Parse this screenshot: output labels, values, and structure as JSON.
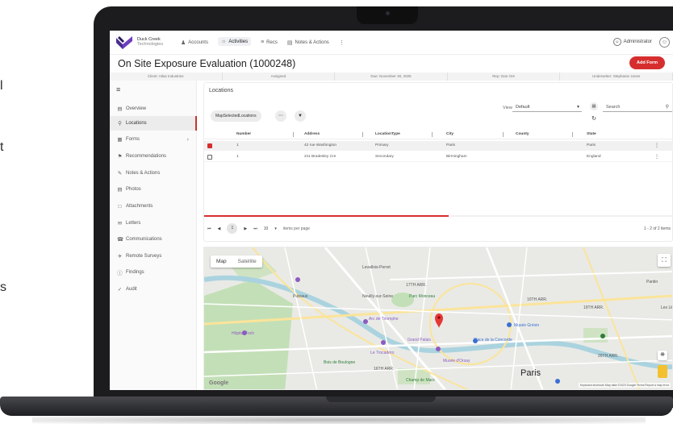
{
  "app": {
    "logo_line1": "Duck Creek",
    "logo_line2": "Technologies",
    "nav": [
      {
        "label": "Accounts",
        "icon": "person-icon"
      },
      {
        "label": "Activities",
        "icon": "activity-icon",
        "active": true
      },
      {
        "label": "Recs",
        "icon": "recs-icon"
      },
      {
        "label": "Notes & Actions",
        "icon": "notes-icon"
      }
    ],
    "user": "Administrator",
    "brand_color": "#d62e2e"
  },
  "page": {
    "title": "On Site Exposure Evaluation (1000248)",
    "add_form": "Add Form"
  },
  "info_strip": [
    "Client: Atlas Industries",
    "Assigned",
    "Due: November 30, 2025",
    "Rep: Dan Ore",
    "Underwriter: Stephanie Jones"
  ],
  "sidebar": {
    "items": [
      {
        "label": "Overview",
        "icon": "overview-icon"
      },
      {
        "label": "Locations",
        "icon": "location-pin-icon",
        "active": true
      },
      {
        "label": "Forms",
        "icon": "forms-icon",
        "chevron": true
      },
      {
        "label": "Recommendations",
        "icon": "recommendations-icon"
      },
      {
        "label": "Notes & Actions",
        "icon": "notes-icon"
      },
      {
        "label": "Photos",
        "icon": "photos-icon"
      },
      {
        "label": "Attachments",
        "icon": "attachment-icon"
      },
      {
        "label": "Letters",
        "icon": "letters-icon"
      },
      {
        "label": "Communications",
        "icon": "communications-icon"
      },
      {
        "label": "Remote Surveys",
        "icon": "remote-surveys-icon"
      },
      {
        "label": "Findings",
        "icon": "findings-icon"
      },
      {
        "label": "Audit",
        "icon": "audit-icon"
      }
    ]
  },
  "locations": {
    "title": "Locations",
    "map_selected_btn": "MapSelectedLocations",
    "view_label": "View",
    "view_value": "Default",
    "search_placeholder": "Search",
    "columns": [
      "Number",
      "Address",
      "LocationType",
      "City",
      "County",
      "State"
    ],
    "rows": [
      {
        "selected": true,
        "number": "1",
        "address": "42 rue Washington",
        "type": "Primary",
        "city": "Paris",
        "county": "",
        "state": "Paris"
      },
      {
        "selected": false,
        "number": "1",
        "address": "211 Bradesley Cre",
        "type": "Secondary",
        "city": "Birmingham",
        "county": "",
        "state": "England"
      }
    ],
    "progress_fraction": 0.52,
    "pager": {
      "page": "1",
      "per_page": "10",
      "per_page_label": "items per page",
      "items_info": "1 - 2 of 2 items"
    }
  },
  "map": {
    "tab_map": "Map",
    "tab_satellite": "Satellite",
    "city": "Paris",
    "labels": [
      {
        "text": "Levallois-Perret",
        "style": ""
      },
      {
        "text": "17TH ARR.",
        "style": ""
      },
      {
        "text": "Parc Monceau",
        "style": "green"
      },
      {
        "text": "Musée Grévin",
        "style": "blue"
      },
      {
        "text": "Grand Palais",
        "style": "purple"
      },
      {
        "text": "Place de la Concorde",
        "style": "blue"
      },
      {
        "text": "Le Trocadéro",
        "style": "purple"
      },
      {
        "text": "Arc de Triomphe",
        "style": "purple"
      },
      {
        "text": "Musée d'Orsay",
        "style": "purple"
      },
      {
        "text": "16TH ARR.",
        "style": ""
      },
      {
        "text": "Champ de Mars",
        "style": "green"
      },
      {
        "text": "Hôpital Foch",
        "style": "purple"
      },
      {
        "text": "Puteaux",
        "style": ""
      },
      {
        "text": "Neuilly-sur-Seine",
        "style": ""
      },
      {
        "text": "19TH ARR.",
        "style": ""
      },
      {
        "text": "20TH ARR.",
        "style": ""
      },
      {
        "text": "10TH ARR.",
        "style": ""
      },
      {
        "text": "Les Lil",
        "style": ""
      },
      {
        "text": "Pantin",
        "style": ""
      },
      {
        "text": "Bois de Boulogne",
        "style": "green"
      }
    ],
    "google": "Google",
    "attribution": "Keyboard shortcuts   Map data ©2023 Google   Terms   Report a map error"
  },
  "left_fragments": [
    "l",
    "t",
    "s"
  ]
}
